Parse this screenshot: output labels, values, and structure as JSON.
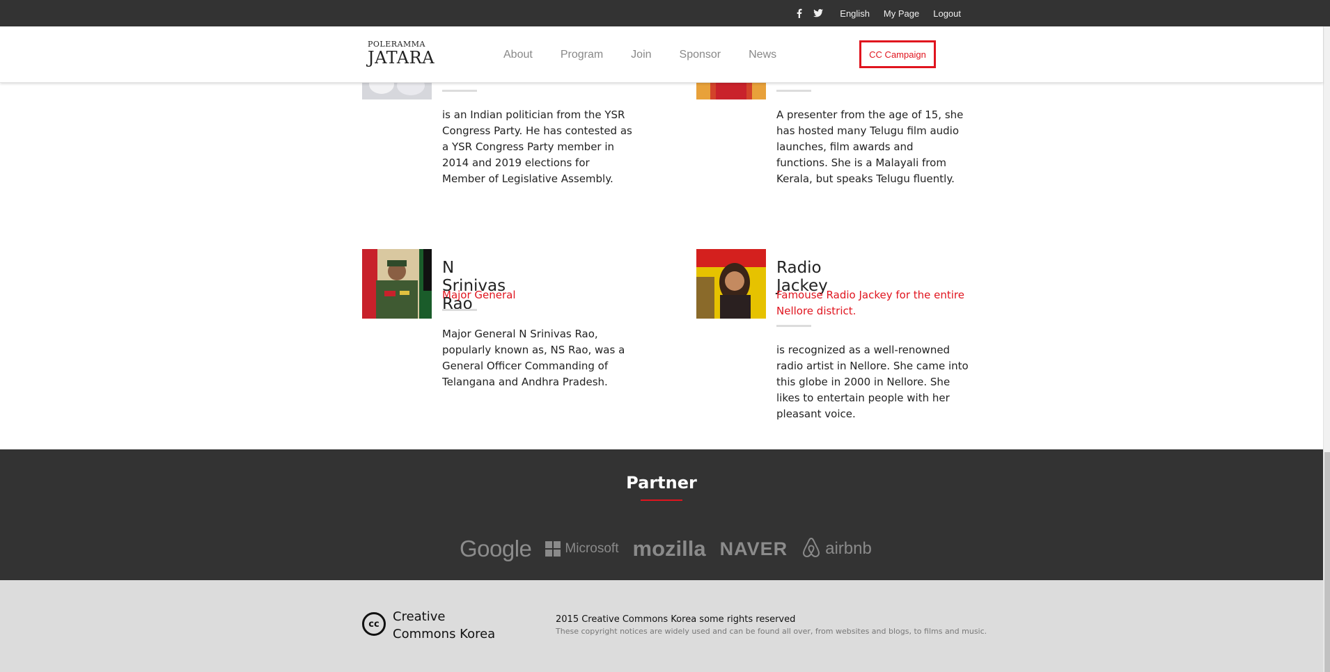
{
  "topbar": {
    "social": [
      "facebook-icon",
      "twitter-icon"
    ],
    "links": [
      "English",
      "My Page",
      "Logout"
    ]
  },
  "header": {
    "logo_small": "POLERAMMA",
    "logo_big": "JATARA",
    "nav": [
      "About",
      "Program",
      "Join",
      "Sponsor",
      "News"
    ],
    "cta": "CC Campaign"
  },
  "people": [
    {
      "name": "",
      "role": "",
      "desc": "is an Indian politician from the YSR Congress Party. He has contested as a YSR Congress Party member in 2014 and 2019 elections for Member of Legislative Assembly."
    },
    {
      "name": "",
      "role": "",
      "desc": "A presenter from the age of 15, she has hosted many Telugu film audio launches, film awards and functions. She is a Malayali from Kerala, but speaks Telugu fluently."
    },
    {
      "name": "N Srinivas Rao",
      "role": "Major General",
      "desc": "Major General N Srinivas Rao, popularly known as, NS Rao, was a General Officer Commanding of Telangana and Andhra Pradesh."
    },
    {
      "name": "Radio Jackey",
      "role": "Famouse Radio Jackey for the entire Nellore district.",
      "desc": "is recognized as a well-renowned radio artist in Nellore. She came into this globe in 2000 in Nellore. She likes to entertain people with her pleasant voice."
    }
  ],
  "partner": {
    "title": "Partner",
    "logos": [
      "Google",
      "Microsoft",
      "mozilla",
      "NAVER",
      "airbnb"
    ]
  },
  "footer": {
    "cc_icon": "cc",
    "org": "Creative Commons Korea",
    "copyright": "2015 Creative Commons Korea some rights reserved",
    "note": "These copyright notices are widely used and can be found all over, from websites and blogs, to films and music."
  },
  "colors": {
    "accent": "#e0141e",
    "dark": "#333333",
    "footer_bg": "#dcdcdc"
  }
}
